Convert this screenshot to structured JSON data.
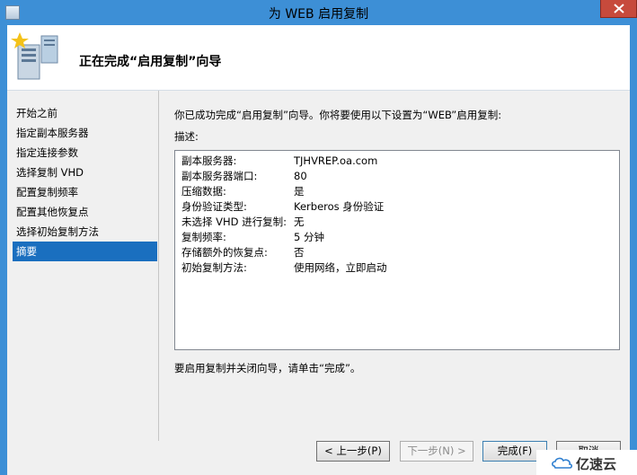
{
  "window": {
    "title": "为 WEB 启用复制",
    "close_icon": "close-icon"
  },
  "header": {
    "title": "正在完成“启用复制”向导",
    "icon": "server-wizard-icon"
  },
  "sidebar": {
    "items": [
      {
        "label": "开始之前",
        "selected": false
      },
      {
        "label": "指定副本服务器",
        "selected": false
      },
      {
        "label": "指定连接参数",
        "selected": false
      },
      {
        "label": "选择复制 VHD",
        "selected": false
      },
      {
        "label": "配置复制频率",
        "selected": false
      },
      {
        "label": "配置其他恢复点",
        "selected": false
      },
      {
        "label": "选择初始复制方法",
        "selected": false
      },
      {
        "label": "摘要",
        "selected": true
      }
    ]
  },
  "main": {
    "intro": "你已成功完成“启用复制”向导。你将要使用以下设置为“WEB”启用复制:",
    "description_label": "描述:",
    "summary": [
      {
        "key": "副本服务器:",
        "value": "TJHVREP.oa.com"
      },
      {
        "key": "副本服务器端口:",
        "value": "80"
      },
      {
        "key": "压缩数据:",
        "value": "是"
      },
      {
        "key": "身份验证类型:",
        "value": "Kerberos 身份验证"
      },
      {
        "key": "未选择 VHD 进行复制:",
        "value": "无"
      },
      {
        "key": "复制频率:",
        "value": "5 分钟"
      },
      {
        "key": "存储额外的恢复点:",
        "value": "否"
      },
      {
        "key": "初始复制方法:",
        "value": "使用网络，立即启动"
      }
    ],
    "footer": "要启用复制并关闭向导，请单击“完成”。"
  },
  "buttons": {
    "prev": "< 上一步(P)",
    "next": "下一步(N) >",
    "finish": "完成(F)",
    "cancel": "取消"
  },
  "watermark": {
    "text": "亿速云"
  }
}
